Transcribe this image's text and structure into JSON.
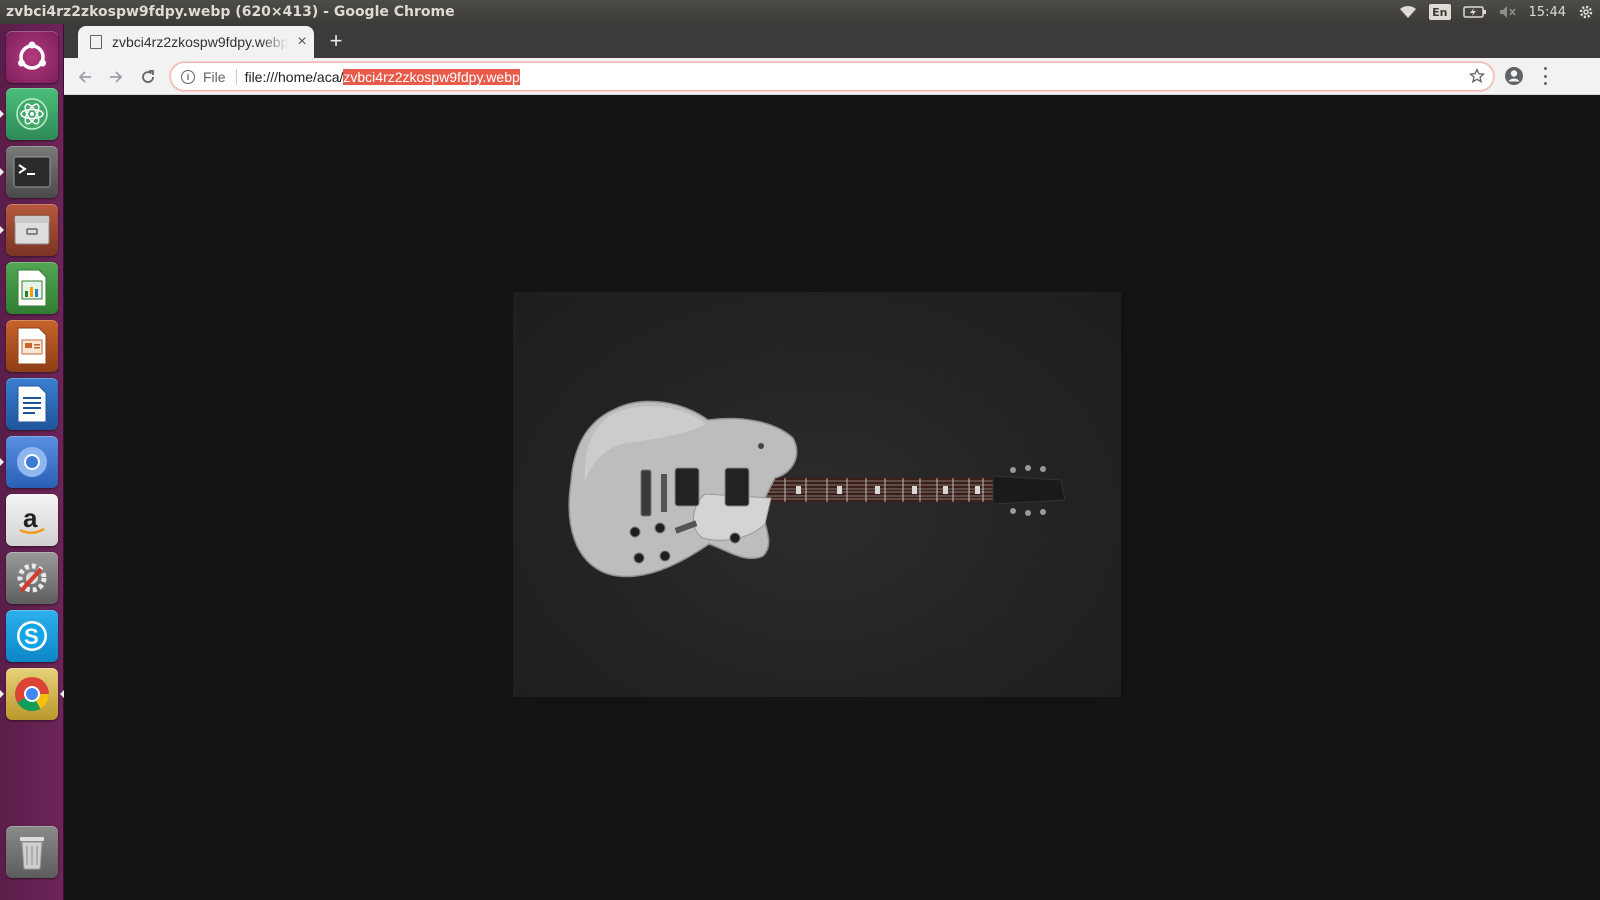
{
  "top_panel": {
    "window_title": "zvbci4rz2zkospw9fdpy.webp (620×413) - Google Chrome",
    "language": "En",
    "clock": "15:44"
  },
  "launcher": {
    "items": [
      {
        "name": "ubuntu-dash"
      },
      {
        "name": "atom-editor"
      },
      {
        "name": "terminal"
      },
      {
        "name": "files"
      },
      {
        "name": "libreoffice-calc"
      },
      {
        "name": "libreoffice-impress"
      },
      {
        "name": "libreoffice-writer"
      },
      {
        "name": "chromium"
      },
      {
        "name": "amazon"
      },
      {
        "name": "system-settings"
      },
      {
        "name": "skype"
      },
      {
        "name": "google-chrome"
      },
      {
        "name": "trash"
      }
    ]
  },
  "browser": {
    "tab": {
      "title": "zvbci4rz2zkospw9fdpy.webp",
      "close": "×"
    },
    "new_tab": "+",
    "omnibox": {
      "scheme_label": "File",
      "url_prefix": "file:///home/aca/",
      "url_selected": "zvbci4rz2zkospw9fdpy.webp"
    }
  },
  "content": {
    "image_description_kind": "photo-of-silver-electric-guitar",
    "image_size_label": "620×413"
  },
  "colors": {
    "launcher_bg": "#6d2559",
    "panel_bg": "#3c3b37",
    "selection": "#e85b4a",
    "viewport_bg": "#131313"
  }
}
